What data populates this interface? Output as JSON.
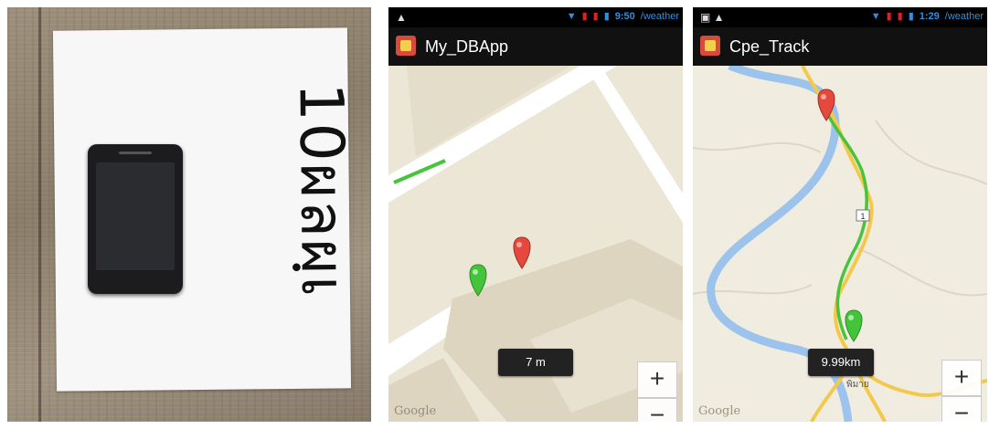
{
  "photo": {
    "sign_text": "10ผลผฺเ"
  },
  "screens": [
    {
      "app_title": "My_DBApp",
      "time": "9:50",
      "carrier_suffix": "/weather",
      "distance_label": "7 m",
      "zoom_in": "+",
      "zoom_out": "−",
      "attribution": "Google"
    },
    {
      "app_title": "Cpe_Track",
      "time": "1:29",
      "carrier_suffix": "/weather",
      "distance_label": "9.99km",
      "zoom_in": "+",
      "zoom_out": "−",
      "attribution": "Google",
      "route_labels": [
        "1",
        "พิมาย"
      ]
    }
  ],
  "colors": {
    "route": "#47c43c",
    "marker_red": "#e5483d",
    "marker_green": "#43c43b",
    "river": "#9cc3ec"
  }
}
